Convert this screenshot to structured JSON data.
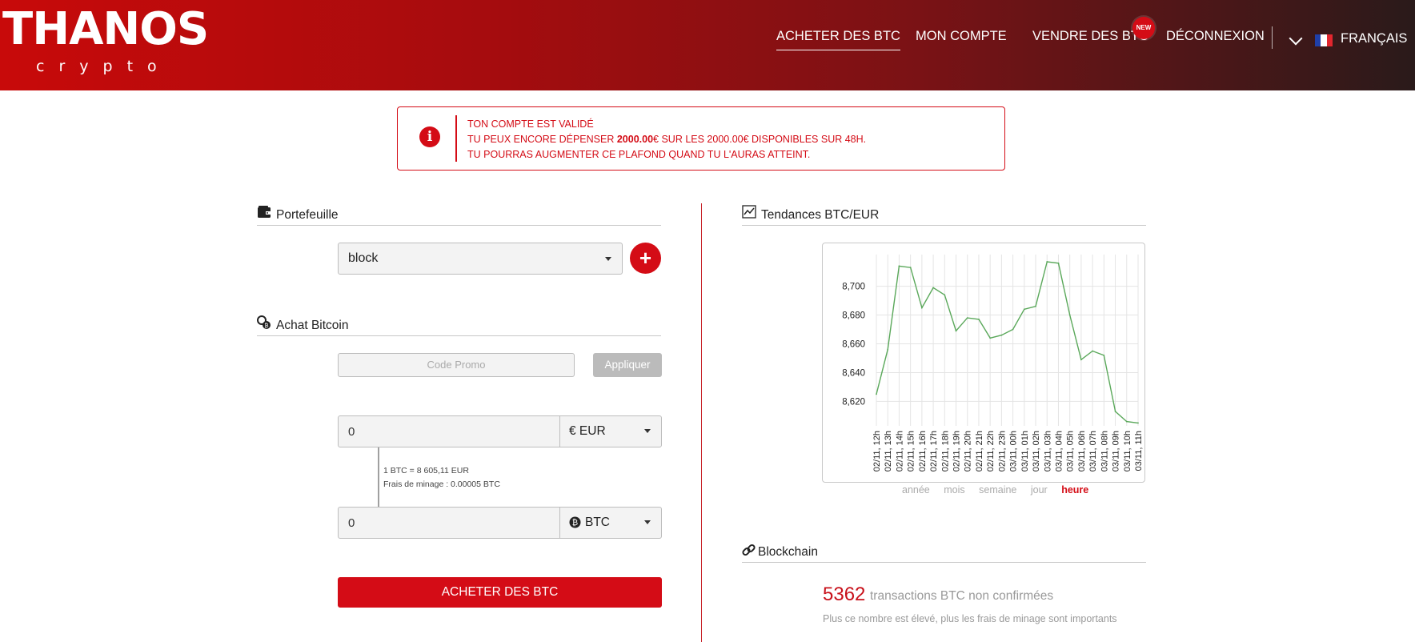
{
  "brand": {
    "name": "THANOS",
    "sub": "crypto"
  },
  "nav": {
    "items": [
      "ACHETER DES BTC",
      "MON COMPTE",
      "VENDRE DES BTC",
      "DÉCONNEXION"
    ],
    "badge": "NEW",
    "language": "FRANÇAIS"
  },
  "alert": {
    "line1": "TON COMPTE EST VALIDÉ",
    "line2_pre": "TU PEUX ENCORE DÉPENSER ",
    "line2_bold": "2000.00",
    "line2_post": "€ SUR LES 2000.00€ DISPONIBLES SUR 48H.",
    "line3": "TU POURRAS AUGMENTER CE PLAFOND QUAND TU L'AURAS ATTEINT."
  },
  "wallet": {
    "title": "Portefeuille",
    "selected": "block",
    "add_label": "+"
  },
  "purchase": {
    "title": "Achat Bitcoin",
    "promo_placeholder": "Code Promo",
    "apply_label": "Appliquer",
    "eur_value": "0",
    "eur_currency": "€ EUR",
    "btc_value": "0",
    "btc_currency": "BTC",
    "rate_line": "1 BTC =  8 605,11 EUR",
    "fee_line": "Frais de minage : 0.00005 BTC",
    "buy_label": "ACHETER DES BTC"
  },
  "trends": {
    "title": "Tendances BTC/EUR",
    "periods": [
      "année",
      "mois",
      "semaine",
      "jour",
      "heure"
    ],
    "active_period": "heure"
  },
  "chart_data": {
    "type": "line",
    "title": "",
    "xlabel": "",
    "ylabel": "",
    "x": [
      "02/11, 12h",
      "02/11, 13h",
      "02/11, 14h",
      "02/11, 15h",
      "02/11, 16h",
      "02/11, 17h",
      "02/11, 18h",
      "02/11, 19h",
      "02/11, 20h",
      "02/11, 21h",
      "02/11, 22h",
      "02/11, 23h",
      "03/11, 00h",
      "03/11, 01h",
      "03/11, 02h",
      "03/11, 03h",
      "03/11, 04h",
      "03/11, 05h",
      "03/11, 06h",
      "03/11, 07h",
      "03/11, 08h",
      "03/11, 09h",
      "03/11, 10h",
      "03/11, 11h"
    ],
    "series": [
      {
        "color": "#5aa85a",
        "values": [
          8625,
          8656,
          8714,
          8713,
          8685,
          8699,
          8694,
          8669,
          8678,
          8677,
          8664,
          8666,
          8670,
          8684,
          8686,
          8717,
          8716,
          8680,
          8649,
          8655,
          8652,
          8613,
          8606,
          8605
        ]
      }
    ],
    "yticks": [
      "8,620",
      "8,640",
      "8,660",
      "8,680",
      "8,700"
    ],
    "ylim": [
      8603,
      8722
    ],
    "grid": true
  },
  "blockchain": {
    "title": "Blockchain",
    "count": "5362",
    "count_label": "transactions BTC non confirmées",
    "note": "Plus ce nombre est élevé, plus les frais de minage sont importants"
  },
  "colors": {
    "accent": "#d40c16",
    "line": "#5aa85a"
  }
}
